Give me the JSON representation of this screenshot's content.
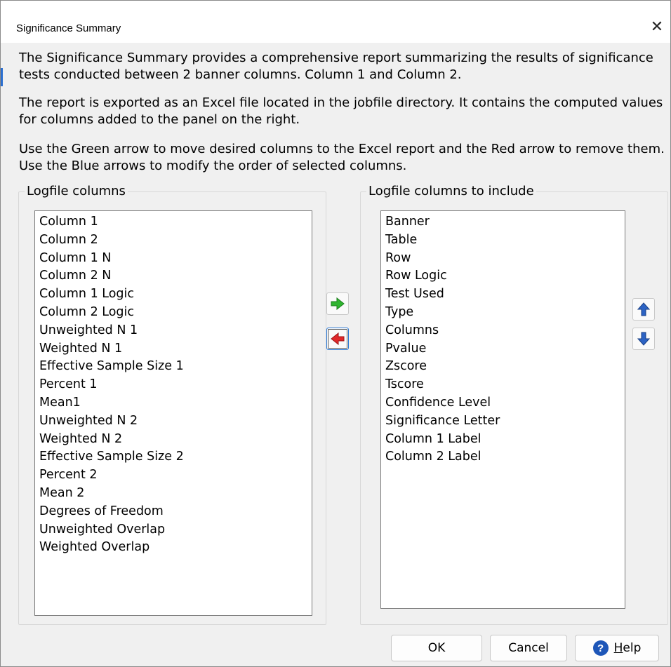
{
  "window": {
    "title": "Significance Summary",
    "close_glyph": "✕"
  },
  "description": {
    "p1": "The Significance Summary provides a comprehensive report summarizing the results of significance tests conducted between 2 banner columns. Column 1 and Column 2.",
    "p2": "The report is exported as an Excel file located in the jobfile directory. It contains the computed values for columns added to the panel on the right.",
    "p3": "Use the Green arrow to move desired columns to the Excel report and the Red arrow to remove them. Use the Blue arrows to modify the order of selected columns."
  },
  "available": {
    "label": "Logfile columns",
    "items": [
      "Column 1",
      "Column 2",
      "Column 1 N",
      "Column 2 N",
      "Column 1 Logic",
      "Column 2 Logic",
      "Unweighted N 1",
      "Weighted N 1",
      "Effective Sample Size 1",
      "Percent 1",
      "Mean1",
      "Unweighted N 2",
      "Weighted N 2",
      "Effective Sample Size 2",
      "Percent 2",
      "Mean 2",
      "Degrees of Freedom",
      "Unweighted Overlap",
      "Weighted Overlap"
    ]
  },
  "selected": {
    "label": "Logfile columns to include",
    "items": [
      "Banner",
      "Table",
      "Row",
      "Row Logic",
      "Test Used",
      "Type",
      "Columns",
      "Pvalue",
      "Zscore",
      "Tscore",
      "Confidence Level",
      "Significance Letter",
      "Column 1 Label",
      "Column 2 Label"
    ]
  },
  "icons": {
    "add": "green-right-arrow-icon",
    "remove": "red-left-arrow-icon",
    "up": "blue-up-arrow-icon",
    "down": "blue-down-arrow-icon",
    "help": "help-icon"
  },
  "colors": {
    "add_arrow": "#2fb52f",
    "remove_arrow": "#e0282a",
    "order_arrows": "#2c63c4",
    "help_icon": "#1d56b8"
  },
  "buttons": {
    "ok": "OK",
    "cancel": "Cancel",
    "help_mnemonic": "H",
    "help_rest": "elp",
    "help_glyph": "?"
  }
}
